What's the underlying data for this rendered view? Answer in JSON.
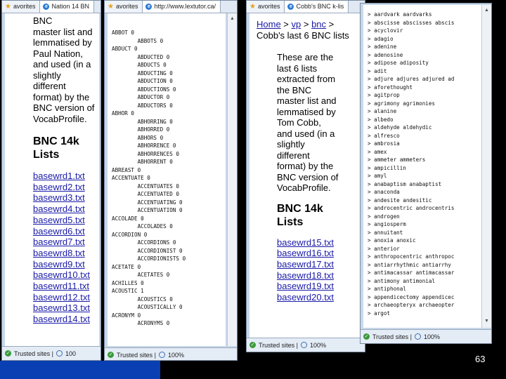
{
  "slide_number": "63",
  "window1": {
    "tabs": [
      "avorites",
      "Nation 14 BN"
    ],
    "intro_lines": [
      "BNC",
      "master list and",
      "lemmatised by",
      "Paul Nation,",
      "and used (in a",
      "slightly",
      "different",
      "format) by the",
      "BNC version of",
      "VocabProfile."
    ],
    "heading_lines": [
      "BNC 14k",
      "Lists"
    ],
    "links": [
      "basewrd1.txt",
      "basewrd2.txt",
      "basewrd3.txt",
      "basewrd4.txt",
      "basewrd5.txt",
      "basewrd6.txt",
      "basewrd7.txt",
      "basewrd8.txt",
      "basewrd9.txt",
      "basewrd10.txt",
      "basewrd11.txt",
      "basewrd12.txt",
      "basewrd13.txt",
      "basewrd14.txt"
    ],
    "status": {
      "trusted": "Trusted sites |",
      "zoom": "100"
    }
  },
  "window2": {
    "tabs": [
      "avorites",
      "http://www.lextutor.ca/"
    ],
    "lines": [
      "ABBOT 0",
      "        ABBOTS 0",
      "ABDUCT 0",
      "        ABDUCTED 0",
      "        ABDUCTS 0",
      "        ABDUCTING 0",
      "        ABDUCTION 0",
      "        ABDUCTIONS 0",
      "        ABDUCTOR 0",
      "        ABDUCTORS 0",
      "ABHOR 0",
      "        ABHORRING 0",
      "        ABHORRED 0",
      "        ABHORS 0",
      "        ABHORRENCE 0",
      "        ABHORRENCES 0",
      "        ABHORRENT 0",
      "ABREAST 0",
      "ACCENTUATE 0",
      "        ACCENTUATES 0",
      "        ACCENTUATED 0",
      "        ACCENTUATING 0",
      "        ACCENTUATION 0",
      "ACCOLADE 0",
      "        ACCOLADES 0",
      "ACCORDION 0",
      "        ACCORDIONS 0",
      "        ACCORDIONIST 0",
      "        ACCORDIONISTS 0",
      "ACETATE 0",
      "        ACETATES 0",
      "ACHILLES 0",
      "ACOUSTIC 1",
      "        ACOUSTICS 0",
      "        ACOUSTICALLY 0",
      "ACRONYM 0",
      "        ACRONYMS 0"
    ],
    "status": {
      "trusted": "Trusted sites |",
      "zoom": "100%"
    }
  },
  "window3": {
    "tabs": [
      "avorites",
      "Cobb's BNC k-lis"
    ],
    "breadcrumb": {
      "home": "Home",
      "sep1": " > ",
      "vp": "vp",
      "sep2": " > ",
      "bnc": "bnc",
      "sep3": " >"
    },
    "subtitle": "Cobb's last 6 BNC lists",
    "intro_lines": [
      "These are the",
      "last 6 lists",
      "extracted from",
      "the BNC",
      "master list and",
      "lemmatised by",
      "Tom Cobb,",
      "and used (in a",
      "slightly",
      "different",
      "format) by the",
      "BNC version of",
      "VocabProfile."
    ],
    "heading_lines": [
      "BNC 14k",
      "Lists"
    ],
    "links": [
      "basewrd15.txt",
      "basewrd16.txt",
      "basewrd17.txt",
      "basewrd18.txt",
      "basewrd19.txt",
      "basewrd20.txt"
    ],
    "status": {
      "trusted": "Trusted sites |",
      "zoom": "100%"
    }
  },
  "window4": {
    "lines": [
      "> aardvark aardvarks",
      "> abscisse abscisses abscis",
      "> acyclovir",
      "> adagio",
      "> adenine",
      "> adenosine",
      "> adipose adiposity",
      "> adit",
      "> adjure adjures adjured ad",
      "> aforethought",
      "> agitprop",
      "> agrimony agrimonies",
      "> alanine",
      "> albedo",
      "> aldehyde aldehydic",
      "> alfresco",
      "> ambrosia",
      "> amex",
      "> ammeter ammeters",
      "> ampicillin",
      "> amyl",
      "> anabaptism anabaptist",
      "> anaconda",
      "> andesite andesitic",
      "> androcentric androcentris",
      "> androgen",
      "> angiosperm",
      "> annuitant",
      "> anoxia anoxic",
      "> anterior",
      "> anthropocentric anthropoc",
      "> antiarrhythmic antiarrhy",
      "> antimacassar antimacassar",
      "> antimony antimonial",
      "> antiphonal",
      "> appendicectomy appendicec",
      "> archaeopteryx archaeopter",
      "> argot"
    ],
    "status": {
      "trusted": "Trusted sites |",
      "zoom": "100%"
    }
  }
}
